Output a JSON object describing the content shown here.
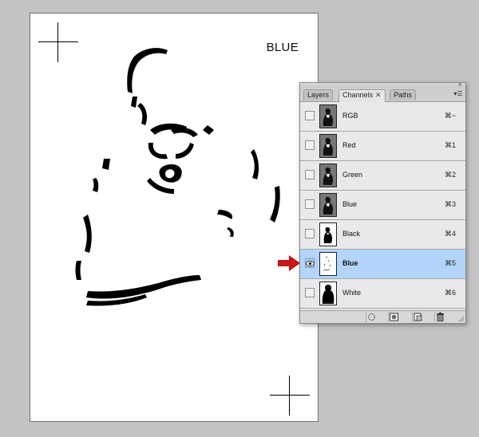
{
  "document": {
    "label": "BLUE"
  },
  "palette": {
    "tabs": [
      {
        "label": "Layers",
        "active": false
      },
      {
        "label": "Channels",
        "active": true,
        "close": "✕"
      },
      {
        "label": "Paths",
        "active": false
      }
    ],
    "close_glyph": "×",
    "menu_glyph": "▾☰",
    "channels": [
      {
        "name": "RGB",
        "shortcut": "⌘~",
        "visible": false,
        "selected": false
      },
      {
        "name": "Red",
        "shortcut": "⌘1",
        "visible": false,
        "selected": false
      },
      {
        "name": "Green",
        "shortcut": "⌘2",
        "visible": false,
        "selected": false
      },
      {
        "name": "Blue",
        "shortcut": "⌘3",
        "visible": false,
        "selected": false
      },
      {
        "name": "Black",
        "shortcut": "⌘4",
        "visible": false,
        "selected": false
      },
      {
        "name": "Blue",
        "shortcut": "⌘5",
        "visible": true,
        "selected": true
      },
      {
        "name": "White",
        "shortcut": "⌘6",
        "visible": false,
        "selected": false
      }
    ],
    "footer_buttons": [
      "load-selection-icon",
      "save-selection-icon",
      "new-channel-icon",
      "trash-icon"
    ]
  },
  "colors": {
    "selected_row": "#b3d4fb",
    "arrow": "#c8141b",
    "background": "#c3c3c3"
  }
}
